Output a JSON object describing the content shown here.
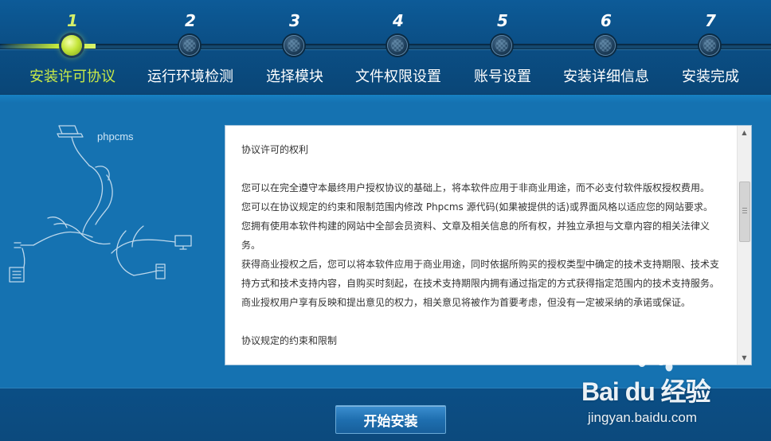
{
  "steps": [
    {
      "number": "1",
      "label": "安装许可协议"
    },
    {
      "number": "2",
      "label": "运行环境检测"
    },
    {
      "number": "3",
      "label": "选择模块"
    },
    {
      "number": "4",
      "label": "文件权限设置"
    },
    {
      "number": "5",
      "label": "账号设置"
    },
    {
      "number": "6",
      "label": "安装详细信息"
    },
    {
      "number": "7",
      "label": "安装完成"
    }
  ],
  "current_step": 1,
  "logo": {
    "text": "phpcms"
  },
  "license": {
    "paragraphs": [
      "协议许可的权利",
      "",
      "您可以在完全遵守本最终用户授权协议的基础上，将本软件应用于非商业用途，而不必支付软件版权授权费用。",
      "您可以在协议规定的约束和限制范围内修改 Phpcms 源代码(如果被提供的话)或界面风格以适应您的网站要求。",
      "您拥有使用本软件构建的网站中全部会员资料、文章及相关信息的所有权，并独立承担与文章内容的相关法律义务。",
      "获得商业授权之后，您可以将本软件应用于商业用途，同时依据所购买的授权类型中确定的技术支持期限、技术支持方式和技术支持内容，自购买时刻起，在技术支持期限内拥有通过指定的方式获得指定范围内的技术支持服务。",
      "商业授权用户享有反映和提出意见的权力，相关意见将被作为首要考虑，但没有一定被采纳的承诺或保证。",
      "",
      "协议规定的约束和限制"
    ]
  },
  "footer": {
    "start_button": "开始安装"
  },
  "watermark": {
    "brand": "Bai du 经验",
    "url": "jingyan.baidu.com"
  },
  "colors": {
    "accent_active": "#c8ea48",
    "background": "#1572b1",
    "header": "#0b4f86"
  }
}
